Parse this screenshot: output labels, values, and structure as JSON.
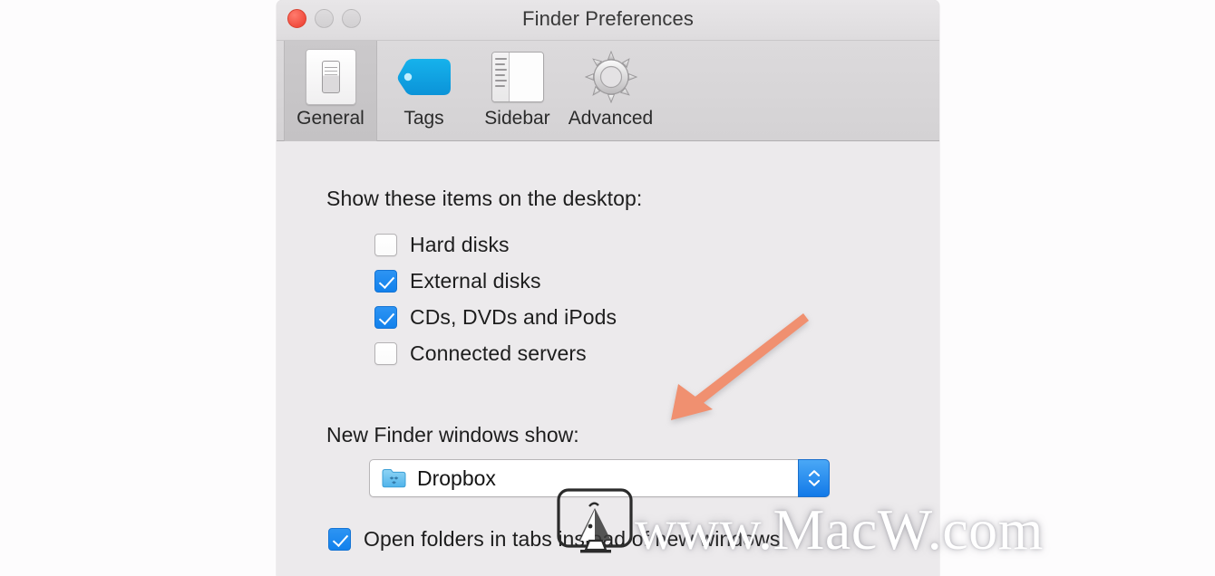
{
  "window": {
    "title": "Finder Preferences",
    "traffic_lights": [
      "close",
      "minimize",
      "zoom"
    ]
  },
  "toolbar": {
    "items": [
      {
        "label": "General",
        "icon": "general-switch-icon",
        "selected": true
      },
      {
        "label": "Tags",
        "icon": "tag-icon",
        "selected": false
      },
      {
        "label": "Sidebar",
        "icon": "sidebar-window-icon",
        "selected": false
      },
      {
        "label": "Advanced",
        "icon": "gear-icon",
        "selected": false
      }
    ]
  },
  "general": {
    "desktop_items_label": "Show these items on the desktop:",
    "checkboxes": [
      {
        "label": "Hard disks",
        "checked": false
      },
      {
        "label": "External disks",
        "checked": true
      },
      {
        "label": "CDs, DVDs and iPods",
        "checked": true
      },
      {
        "label": "Connected servers",
        "checked": false
      }
    ],
    "new_window_label": "New Finder windows show:",
    "new_window_value": "Dropbox",
    "new_window_icon": "dropbox-folder-icon",
    "tabs_option": {
      "label": "Open folders in tabs instead of new windows",
      "checked": true
    }
  },
  "annotation": {
    "arrow": "down-left-arrow",
    "color": "#f0906f"
  },
  "watermark": {
    "text": "www.MacW.com",
    "logo": "monitor-logo-icon"
  },
  "colors": {
    "accent_blue": "#1c8af0",
    "window_bg": "#eceaec",
    "toolbar_bg": "#d6d4d6",
    "title_text": "#383838",
    "body_text": "#1d1d1d",
    "close_red": "#f04a3c",
    "tag_blue": "#0fa2e3",
    "annotation_salmon": "#f0906f"
  }
}
